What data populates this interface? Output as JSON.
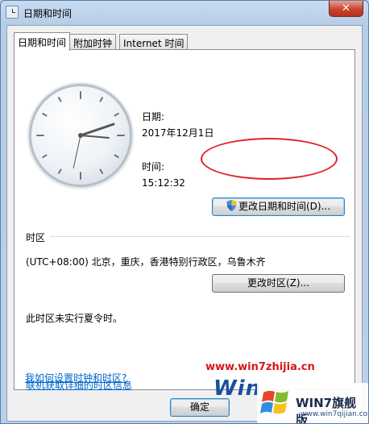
{
  "window": {
    "title": "日期和时间",
    "close_label": "✕"
  },
  "tabs": [
    {
      "label": "日期和时间",
      "active": true
    },
    {
      "label": "附加时钟",
      "active": false
    },
    {
      "label": "Internet 时间",
      "active": false
    }
  ],
  "date": {
    "label": "日期:",
    "value": "2017年12月1日"
  },
  "time": {
    "label": "时间:",
    "value": "15:12:32"
  },
  "change_datetime_button": "更改日期和时间(D)...",
  "timezone": {
    "section_label": "时区",
    "value": "(UTC+08:00) 北京，重庆，香港特别行政区，乌鲁木齐",
    "change_button": "更改时区(Z)...",
    "dst_note": "此时区未实行夏令时。"
  },
  "links": {
    "timezone_info": "联机获取详细的时区信息",
    "how_to_set": "我如何设置时钟和时区?"
  },
  "ok_button": "确定",
  "watermark": {
    "url": "www.win7zhijia.cn",
    "win_text": "Win",
    "badge_text": "WIN7旗舰版",
    "sub_text": "www.win7qijian.com"
  },
  "colors": {
    "accent_blue": "#3c7fb1",
    "link": "#0066cc",
    "highlight_ring": "#e0242a"
  }
}
